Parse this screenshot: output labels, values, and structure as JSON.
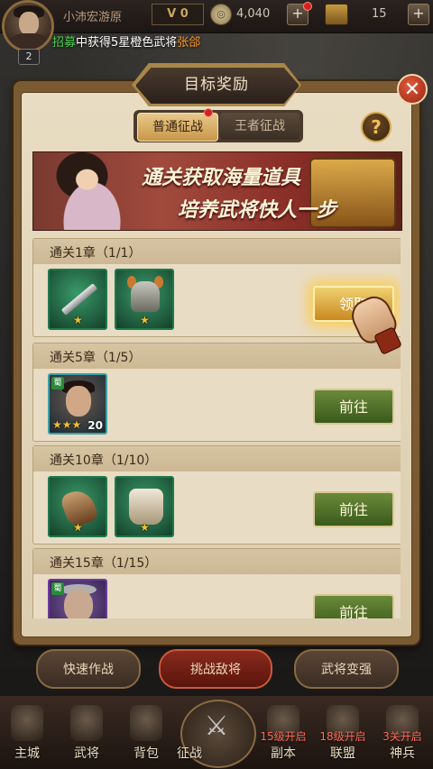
{
  "topbar": {
    "player_name": "小沛宏游原",
    "level": "2",
    "vip": "V 0",
    "coins": "4,040",
    "resource": "15"
  },
  "ticker": {
    "part1": "招募",
    "part2": "中获得5星橙色武将",
    "part3": "张郃"
  },
  "panel": {
    "title": "目标奖励",
    "close": "✕",
    "help": "?",
    "tabs": [
      {
        "label": "普通征战",
        "active": true
      },
      {
        "label": "王者征战",
        "active": false
      }
    ],
    "banner": {
      "line1": "通关获取海量道具",
      "line2": "培养武将快人一步"
    }
  },
  "rewards": [
    {
      "title": "通关1章（1/1）",
      "button": "领取",
      "items": [
        "sword",
        "helmet"
      ]
    },
    {
      "title": "通关5章（1/5）",
      "button": "前往",
      "items": [
        "hero"
      ],
      "hero_count": "20",
      "faction": "蜀"
    },
    {
      "title": "通关10章（1/10）",
      "button": "前往",
      "items": [
        "glove",
        "armor"
      ]
    },
    {
      "title": "通关15章（1/15）",
      "button": "前往",
      "items": [
        "hero"
      ],
      "faction": "蜀"
    }
  ],
  "actions": {
    "quick_battle": "快速作战",
    "challenge": "挑战敌将",
    "strengthen": "武将变强"
  },
  "nav": {
    "city": "主城",
    "generals": "武将",
    "bag": "背包",
    "campaign": "征战",
    "dungeon": "副本",
    "dungeon_lock": "15级开启",
    "alliance": "联盟",
    "alliance_lock": "18级开启",
    "divine": "神兵",
    "divine_lock": "3关开启"
  },
  "colors": {
    "accent_gold": "#c88a20",
    "button_green": "#3a5a1c",
    "close_red": "#9a2414"
  }
}
